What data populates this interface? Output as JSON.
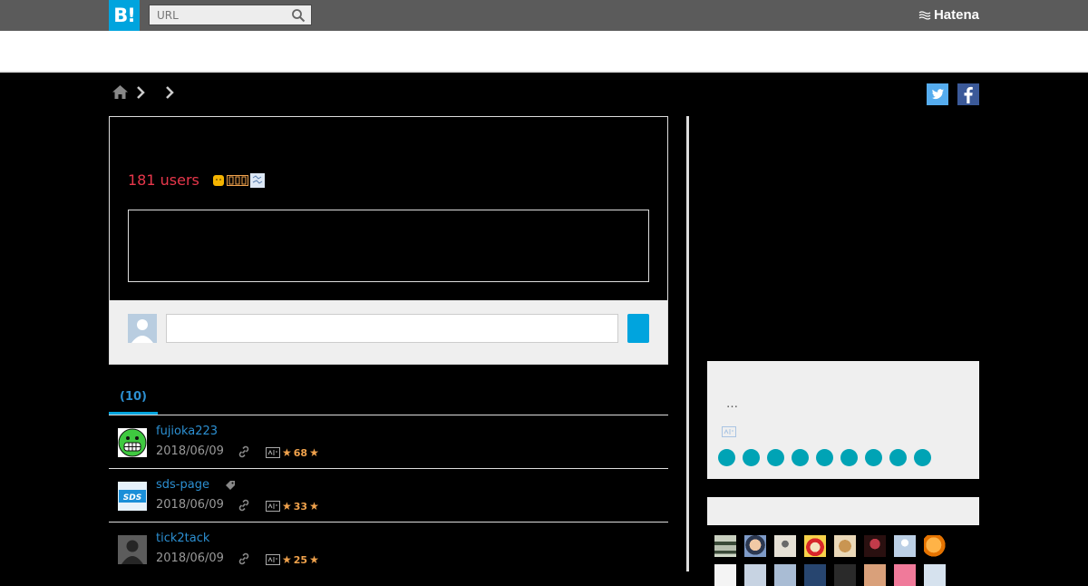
{
  "header": {
    "logo": "B!",
    "search_placeholder": "URL",
    "brand": "Hatena"
  },
  "entry": {
    "users_count": "181 users"
  },
  "tabs": [
    {
      "label": "(10)"
    }
  ],
  "bookmarks": [
    {
      "user": "fujioka223",
      "date": "2018/06/09",
      "stars": "68"
    },
    {
      "user": "sds-page",
      "date": "2018/06/09",
      "stars": "33"
    },
    {
      "user": "tick2tack",
      "date": "2018/06/09",
      "stars": "25"
    }
  ],
  "sidebar": {
    "ellipsis": "…"
  },
  "colors": {
    "accent": "#00a4de",
    "users": "#e8374b",
    "link": "#2c8fd1",
    "star": "#f0a24c",
    "circle": "#00a3b5"
  }
}
